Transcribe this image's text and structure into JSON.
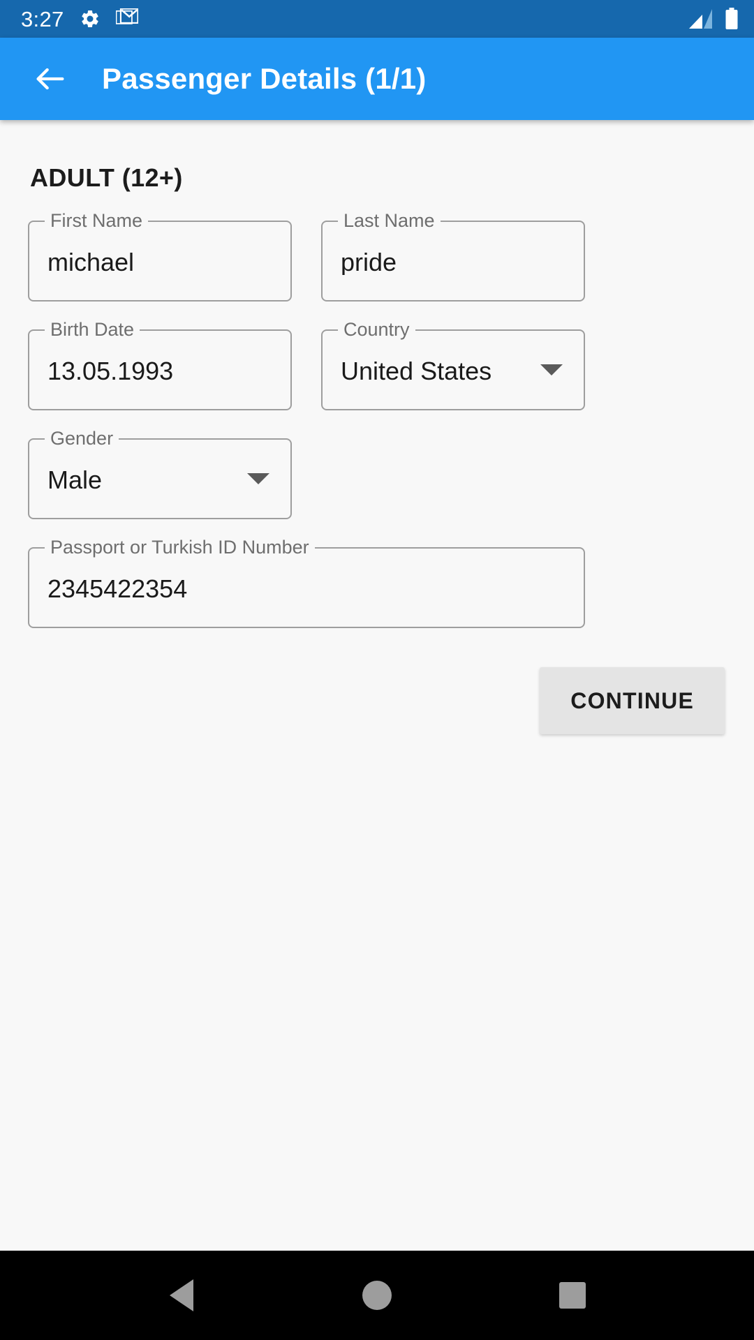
{
  "status_bar": {
    "time": "3:27",
    "icons": [
      "gear-icon",
      "gmail-icon"
    ],
    "right_icons": [
      "signal-icon",
      "battery-icon"
    ],
    "background_color": "#1668ad"
  },
  "app_bar": {
    "back_icon": "back-arrow-icon",
    "title": "Passenger Details (1/1)",
    "background_color": "#2196f3"
  },
  "form": {
    "section_title": "ADULT (12+)",
    "fields": [
      {
        "label": "First Name",
        "value": "michael",
        "type": "text",
        "dropdown": false
      },
      {
        "label": "Last Name",
        "value": "pride",
        "type": "text",
        "dropdown": false
      },
      {
        "label": "Birth Date",
        "value": "13.05.1993",
        "type": "date",
        "dropdown": false
      },
      {
        "label": "Country",
        "value": "United States",
        "type": "select",
        "dropdown": true
      },
      {
        "label": "Gender",
        "value": "Male",
        "type": "select",
        "dropdown": true
      },
      {
        "label": "Passport or Turkish ID Number",
        "value": "2345422354",
        "type": "text",
        "dropdown": false
      }
    ],
    "continue_label": "CONTINUE",
    "continue_color": "#e4e4e4"
  },
  "nav_bar": {
    "back_label": "back-triangle-icon",
    "home_label": "home-circle-icon",
    "recent_label": "recents-square-icon",
    "background_color": "#000000"
  }
}
